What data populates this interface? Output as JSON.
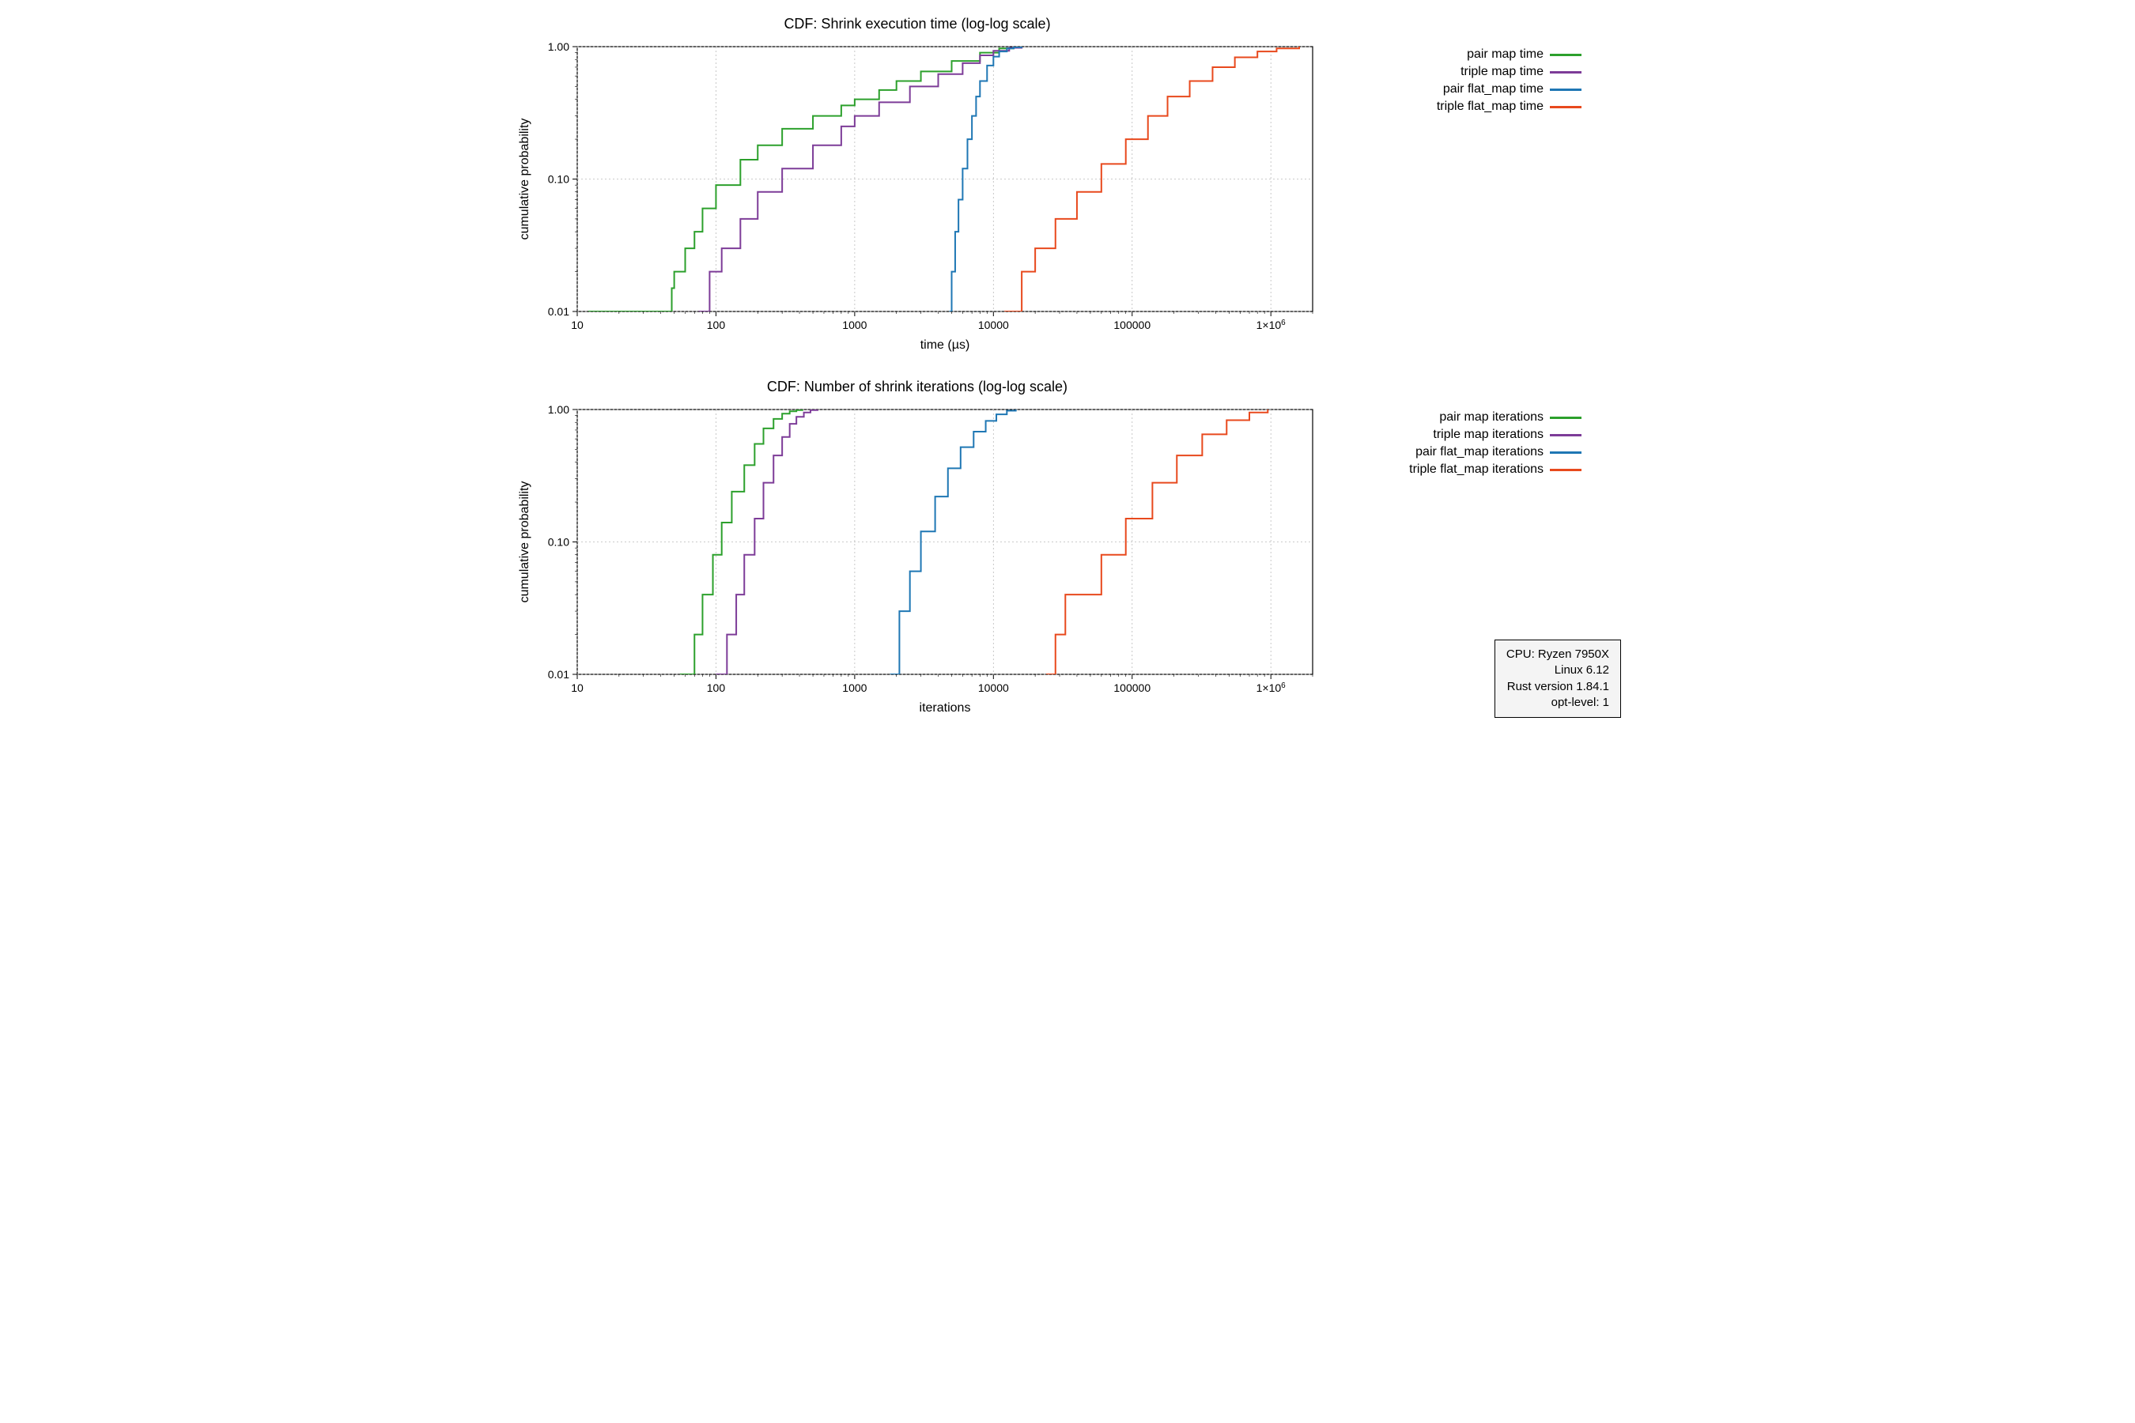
{
  "chart_data": [
    {
      "type": "line",
      "title": "CDF: Shrink execution time (log-log scale)",
      "xlabel": "time (µs)",
      "ylabel": "cumulative probability",
      "xscale": "log",
      "yscale": "log",
      "xlim": [
        10,
        2000000
      ],
      "ylim": [
        0.01,
        1.0
      ],
      "xticks": [
        10,
        100,
        1000,
        10000,
        100000,
        1000000
      ],
      "xtick_labels": [
        "10",
        "100",
        "1000",
        "10000",
        "100000",
        "1x10^6"
      ],
      "yticks": [
        0.01,
        0.1,
        1.0
      ],
      "ytick_labels": [
        "0.01",
        "0.10",
        "1.00"
      ],
      "legend_position": "right",
      "grid": true,
      "series": [
        {
          "name": "pair map time",
          "color": "#2ca02c",
          "x": [
            12,
            48,
            50,
            60,
            70,
            80,
            100,
            150,
            200,
            300,
            500,
            800,
            1000,
            1500,
            2000,
            3000,
            5000,
            8000,
            11000,
            14000
          ],
          "y": [
            0.01,
            0.015,
            0.02,
            0.03,
            0.04,
            0.06,
            0.09,
            0.14,
            0.18,
            0.24,
            0.3,
            0.36,
            0.4,
            0.47,
            0.55,
            0.65,
            0.78,
            0.9,
            0.97,
            1.0
          ]
        },
        {
          "name": "triple map time",
          "color": "#7d3c98",
          "x": [
            75,
            90,
            110,
            150,
            200,
            300,
            500,
            800,
            1000,
            1500,
            2500,
            4000,
            6000,
            8000,
            10000,
            13000,
            16000
          ],
          "y": [
            0.01,
            0.02,
            0.03,
            0.05,
            0.08,
            0.12,
            0.18,
            0.25,
            0.3,
            0.38,
            0.5,
            0.62,
            0.75,
            0.86,
            0.93,
            0.98,
            1.0
          ]
        },
        {
          "name": "pair flat_map time",
          "color": "#1f77b4",
          "x": [
            4800,
            5000,
            5300,
            5600,
            6000,
            6500,
            7000,
            7500,
            8000,
            9000,
            10000,
            11000,
            12500,
            14000,
            16000
          ],
          "y": [
            0.01,
            0.02,
            0.04,
            0.07,
            0.12,
            0.2,
            0.3,
            0.42,
            0.55,
            0.72,
            0.84,
            0.92,
            0.97,
            0.99,
            1.0
          ]
        },
        {
          "name": "triple flat_map time",
          "color": "#e8491d",
          "x": [
            12000,
            16000,
            20000,
            28000,
            40000,
            60000,
            90000,
            130000,
            180000,
            260000,
            380000,
            550000,
            800000,
            1100000,
            1600000
          ],
          "y": [
            0.01,
            0.02,
            0.03,
            0.05,
            0.08,
            0.13,
            0.2,
            0.3,
            0.42,
            0.55,
            0.7,
            0.83,
            0.92,
            0.97,
            1.0
          ]
        }
      ]
    },
    {
      "type": "line",
      "title": "CDF: Number of shrink iterations (log-log scale)",
      "xlabel": "iterations",
      "ylabel": "cumulative probability",
      "xscale": "log",
      "yscale": "log",
      "xlim": [
        10,
        2000000
      ],
      "ylim": [
        0.01,
        1.0
      ],
      "xticks": [
        10,
        100,
        1000,
        10000,
        100000,
        1000000
      ],
      "xtick_labels": [
        "10",
        "100",
        "1000",
        "10000",
        "100000",
        "1x10^6"
      ],
      "yticks": [
        0.01,
        0.1,
        1.0
      ],
      "ytick_labels": [
        "0.01",
        "0.10",
        "1.00"
      ],
      "legend_position": "right",
      "grid": true,
      "series": [
        {
          "name": "pair map iterations",
          "color": "#2ca02c",
          "x": [
            55,
            70,
            80,
            95,
            110,
            130,
            160,
            190,
            220,
            260,
            300,
            340,
            380,
            420
          ],
          "y": [
            0.01,
            0.02,
            0.04,
            0.08,
            0.14,
            0.24,
            0.38,
            0.55,
            0.72,
            0.85,
            0.93,
            0.97,
            0.99,
            1.0
          ]
        },
        {
          "name": "triple map iterations",
          "color": "#7d3c98",
          "x": [
            100,
            120,
            140,
            160,
            190,
            220,
            260,
            300,
            340,
            380,
            430,
            480,
            540
          ],
          "y": [
            0.01,
            0.02,
            0.04,
            0.08,
            0.15,
            0.28,
            0.45,
            0.62,
            0.78,
            0.88,
            0.95,
            0.99,
            1.0
          ]
        },
        {
          "name": "pair flat_map iterations",
          "color": "#1f77b4",
          "x": [
            1800,
            2100,
            2500,
            3000,
            3800,
            4700,
            5800,
            7200,
            8800,
            10500,
            12500,
            14500
          ],
          "y": [
            0.01,
            0.03,
            0.06,
            0.12,
            0.22,
            0.36,
            0.52,
            0.68,
            0.82,
            0.92,
            0.98,
            1.0
          ]
        },
        {
          "name": "triple flat_map iterations",
          "color": "#e8491d",
          "x": [
            24000,
            28000,
            33000,
            42000,
            60000,
            90000,
            140000,
            210000,
            320000,
            480000,
            700000,
            950000
          ],
          "y": [
            0.01,
            0.02,
            0.04,
            0.04,
            0.08,
            0.15,
            0.28,
            0.45,
            0.65,
            0.83,
            0.95,
            1.0
          ]
        }
      ]
    }
  ],
  "info_box": {
    "lines": [
      "CPU: Ryzen 7950X",
      "Linux 6.12",
      "Rust version 1.84.1",
      "opt-level: 1"
    ]
  }
}
